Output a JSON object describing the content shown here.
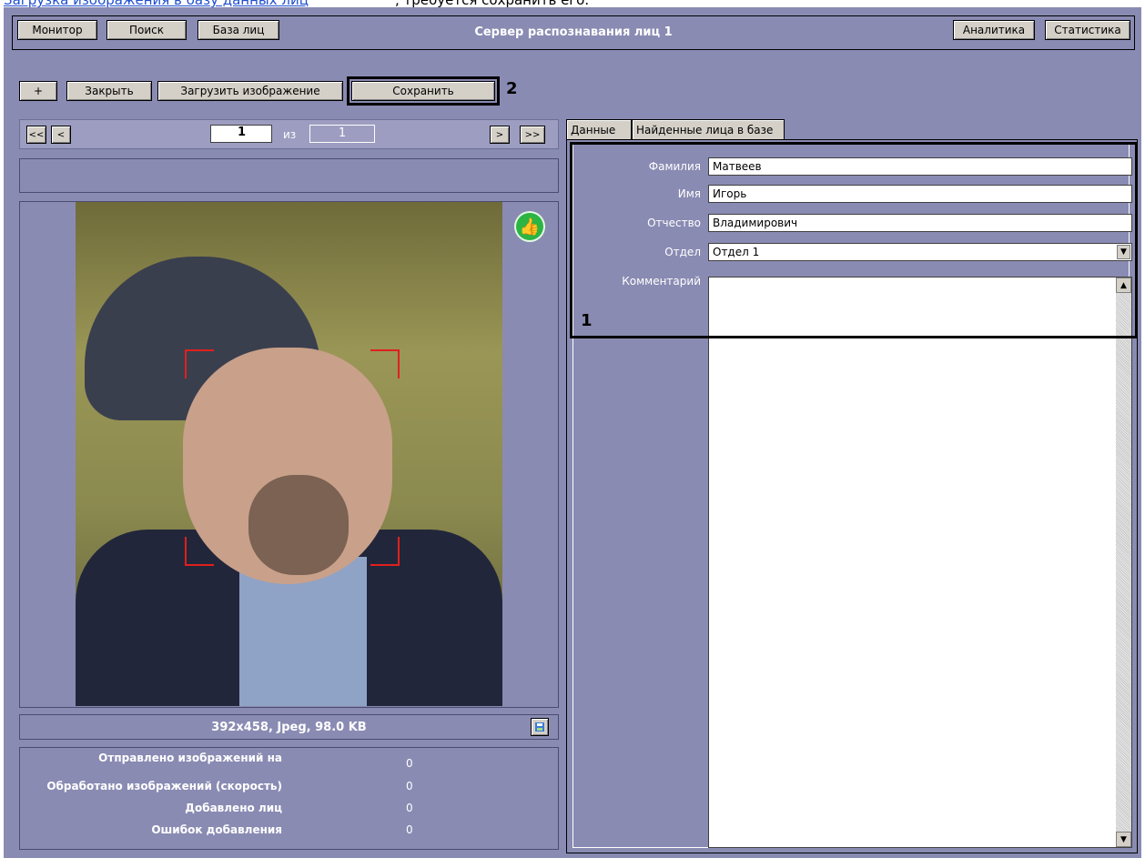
{
  "doc": {
    "link_text": "Загрузка изображения в базу данных лиц",
    "trailing_text": ", требуется сохранить его."
  },
  "header": {
    "monitor": "Монитор",
    "search": "Поиск",
    "face_db": "База лиц",
    "title": "Сервер распознавания лиц 1",
    "analytics": "Аналитика",
    "statistics": "Статистика"
  },
  "toolbar": {
    "add": "+",
    "close": "Закрыть",
    "load_image": "Загрузить изображение",
    "save": "Сохранить",
    "callout_save": "2"
  },
  "navigation": {
    "first": "<<",
    "prev": "<",
    "next": ">",
    "last": ">>",
    "current_page": "1",
    "of_label": "из",
    "total_pages": "1"
  },
  "image_info": "392x458, Jpeg, 98.0 KB",
  "stats": [
    {
      "label": "Отправлено изображений на",
      "value": "0"
    },
    {
      "label": "Обработано изображений (скорость)",
      "value": "0"
    },
    {
      "label": "Добавлено лиц",
      "value": "0"
    },
    {
      "label": "Ошибок добавления",
      "value": "0"
    }
  ],
  "tabs": {
    "data": "Данные",
    "found": "Найденные лица в базе"
  },
  "form": {
    "surname_label": "Фамилия",
    "surname": "Матвеев",
    "name_label": "Имя",
    "name": "Игорь",
    "patronymic_label": "Отчество",
    "patronymic": "Владимирович",
    "department_label": "Отдел",
    "department": "Отдел 1",
    "comment_label": "Комментарий",
    "comment": "",
    "callout_form": "1"
  },
  "icons": {
    "thumb": "thumbs-up-icon",
    "save_image": "save-image-icon"
  },
  "colors": {
    "background": "#8a8bb3",
    "accept": "#2db543",
    "face_frame": "#e0201d"
  }
}
